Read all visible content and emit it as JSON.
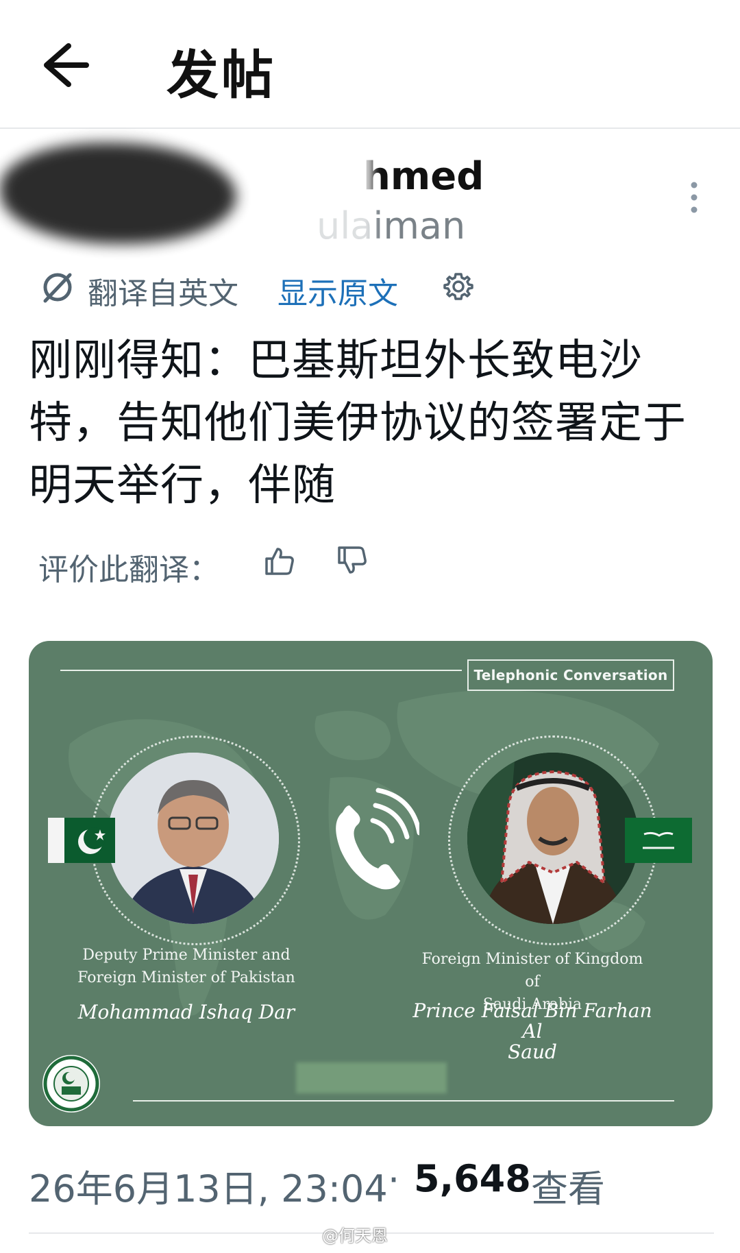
{
  "header": {
    "title": "发帖",
    "back_icon": "arrow-left-icon"
  },
  "author": {
    "name": "hmed",
    "handle": "ulaiman"
  },
  "translation": {
    "translated_from": "翻译自英文",
    "show_original": "显示原文",
    "settings_icon": "gear-icon"
  },
  "post": {
    "text": "刚刚得知：巴基斯坦外长致电沙特，告知他们美伊协议的签署定于明天举行，伴随"
  },
  "rating": {
    "label": "评价此翻译：",
    "up_icon": "thumbs-up-icon",
    "down_icon": "thumbs-down-icon"
  },
  "image_card": {
    "badge": "Telephonic Conversation",
    "left_role_line1": "Deputy Prime Minister and",
    "left_role_line2": "Foreign Minister of Pakistan",
    "left_name": "Mohammad Ishaq Dar",
    "right_role_line1": "Foreign Minister of Kingdom of",
    "right_role_line2": "Saudi Arabia",
    "right_name_line1": "Prince Faisal Bin Farhan Al",
    "right_name_line2": "Saud",
    "background_color": "#5c7e68"
  },
  "meta": {
    "timestamp": "26年6月13日, 23:04",
    "separator": "·",
    "views_count": "5,648",
    "views_label": "查看"
  },
  "watermark": "@何天恩",
  "colors": {
    "link": "#1d70b8",
    "secondary_text": "#536471"
  }
}
